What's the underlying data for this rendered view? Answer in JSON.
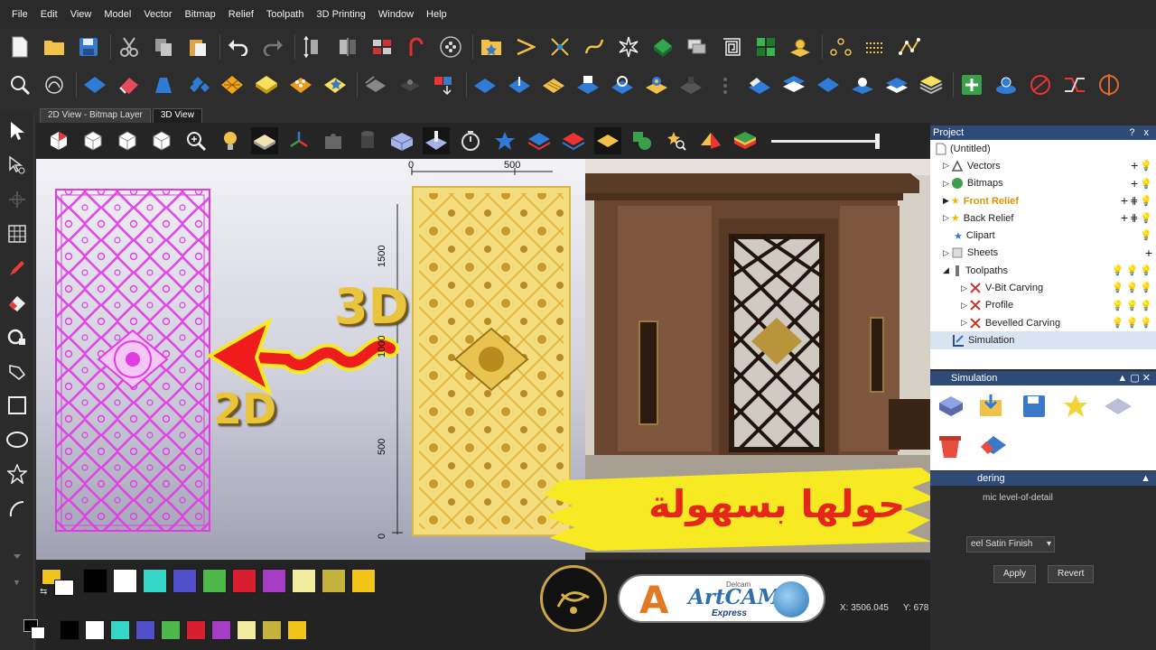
{
  "menu": [
    "File",
    "Edit",
    "View",
    "Model",
    "Vector",
    "Bitmap",
    "Relief",
    "Toolpath",
    "3D Printing",
    "Window",
    "Help"
  ],
  "tabs": [
    "2D View - Bitmap Layer",
    "3D View"
  ],
  "ruler": {
    "top": [
      "0",
      "500"
    ],
    "side": [
      "1500",
      "1000",
      "500",
      "0"
    ]
  },
  "overlay": {
    "label_3d": "3D",
    "label_2d": "2D",
    "arabic_title": "حولها بسهولة"
  },
  "project": {
    "title": "Project",
    "help": "?",
    "close": "x",
    "items": [
      {
        "label": "(Untitled)"
      },
      {
        "label": "Vectors"
      },
      {
        "label": "Bitmaps"
      },
      {
        "label": "Front Relief"
      },
      {
        "label": "Back Relief"
      },
      {
        "label": "Clipart"
      },
      {
        "label": "Sheets"
      },
      {
        "label": "Toolpaths"
      },
      {
        "label": "V-Bit Carving"
      },
      {
        "label": "Profile"
      },
      {
        "label": "Bevelled Carving"
      },
      {
        "label": "Simulation"
      }
    ]
  },
  "simulation": {
    "title": "Simulation"
  },
  "rendering": {
    "title": "dering",
    "lod": "mic level-of-detail",
    "finish": "eel Satin Finish",
    "apply": "Apply",
    "revert": "Revert"
  },
  "status": {
    "x": "X: 3506.045",
    "y": "Y: 678"
  },
  "logo": {
    "brand_top": "Delcam",
    "brand": "ArtCAM",
    "brand_sub": "Express",
    "letter": "A"
  },
  "colors": {
    "menu_bg": "#2a2a2a",
    "panel_header": "#2e4b78",
    "magenta_vector": "#e13be6",
    "relief_gold": "#f2d25a",
    "arrow_red": "#ee1c1c",
    "arrow_yellow": "#f7ea23"
  },
  "palette_top": [
    "#000000",
    "#ffffff",
    "#36d6c9",
    "#4e4fc9",
    "#4fb84a",
    "#d81f2f",
    "#a53ec4",
    "#f2ec9e",
    "#c3b23c",
    "#f0c419"
  ],
  "palette_bottom": [
    "#000000",
    "#ffffff",
    "#36d6c9",
    "#4e4fc9",
    "#4fb84a",
    "#d81f2f",
    "#a53ec4",
    "#f2ec9e",
    "#c3b23c",
    "#f0c419"
  ]
}
